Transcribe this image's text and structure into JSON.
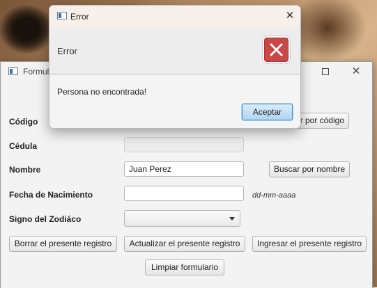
{
  "main_window": {
    "title": "Formulario",
    "fields": {
      "codigo_label": "Código",
      "cedula_label": "Cédula",
      "nombre_label": "Nombre",
      "nombre_value": "Juan Perez",
      "fecha_label": "Fecha de Nacimiento",
      "fecha_hint": "dd-mm-aaaa",
      "signo_label": "Signo del Zodiáco"
    },
    "buttons": {
      "buscar_codigo": "Buscar por código",
      "buscar_nombre": "Buscar por nombre",
      "borrar": "Borrar el presente registro",
      "actualizar": "Actualizar el presente registro",
      "ingresar": "Ingresar el presente registro",
      "limpiar": "Limpiar formulario"
    }
  },
  "error_dialog": {
    "title": "Error",
    "header": "Error",
    "message": "Persona no encontrada!",
    "accept_label": "Aceptar",
    "icon": "error-x-icon",
    "icon_color": "#c94846"
  }
}
